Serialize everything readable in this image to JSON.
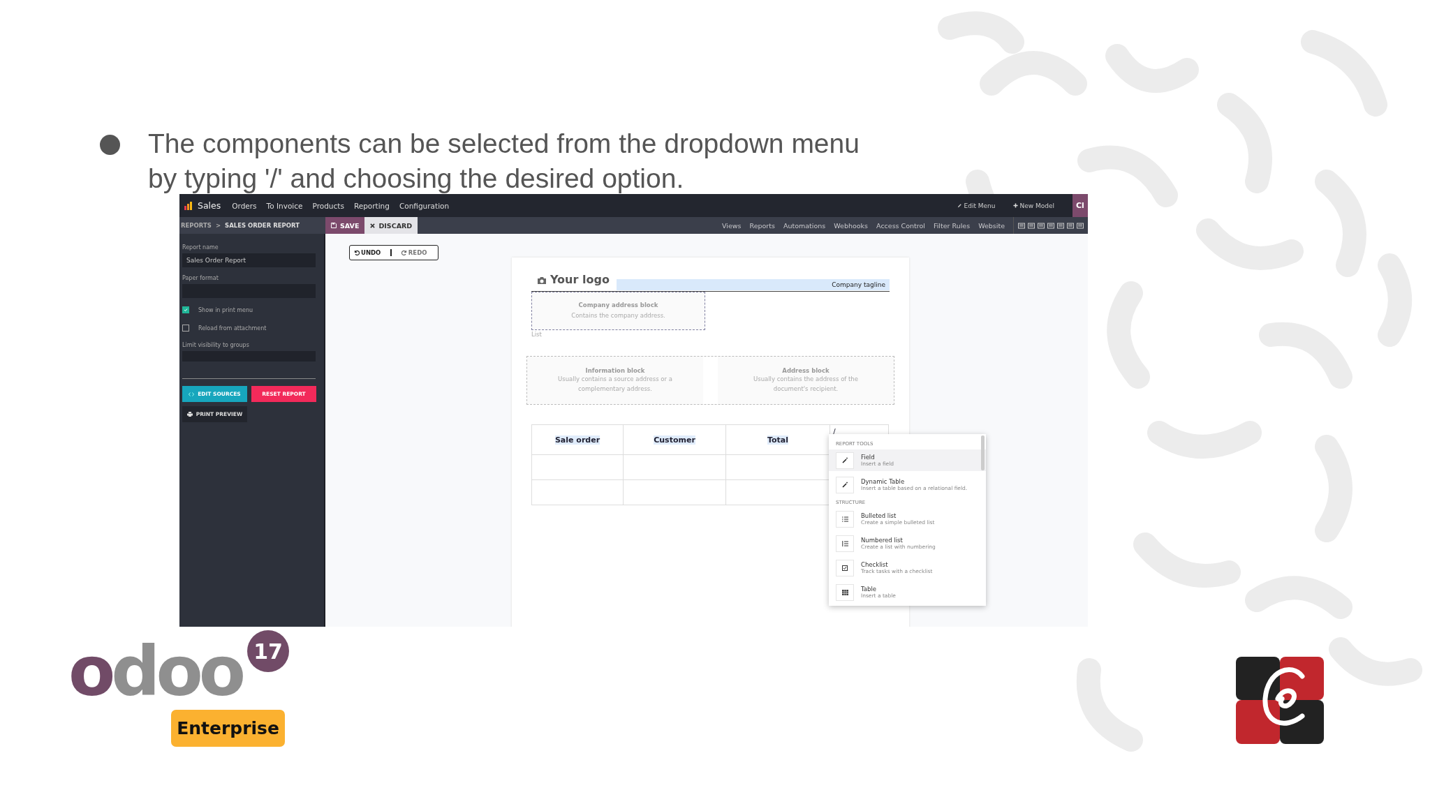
{
  "slide": {
    "bullet_text": "The components can be selected from the dropdown menu by typing '/' and choosing the desired option."
  },
  "app": {
    "app_name": "Sales",
    "menu": [
      "Orders",
      "To Invoice",
      "Products",
      "Reporting",
      "Configuration"
    ],
    "topbar_right": [
      {
        "kind": "edit",
        "label": "Edit Menu"
      },
      {
        "kind": "new",
        "label": "New Model"
      }
    ],
    "close_button": "Cl",
    "breadcrumbs": [
      "REPORTS",
      "SALES ORDER REPORT"
    ],
    "breadcrumb_separator": ">",
    "save": "SAVE",
    "discard": "DISCARD",
    "studio_tabs": [
      "Views",
      "Reports",
      "Automations",
      "Webhooks",
      "Access Control",
      "Filter Rules",
      "Website"
    ]
  },
  "sidebar": {
    "fields": [
      {
        "label": "Report name",
        "value": "Sales Order Report"
      },
      {
        "label": "Paper format"
      }
    ],
    "checkboxes": [
      {
        "label": "Show in print menu",
        "checked": true
      },
      {
        "label": "Reload from attachment",
        "checked": false
      }
    ],
    "groups_label": "Limit visibility to groups",
    "buttons": [
      {
        "kind": "edit",
        "label": "EDIT SOURCES"
      },
      {
        "kind": "reset",
        "label": "RESET REPORT"
      },
      {
        "kind": "print",
        "label": "PRINT PREVIEW"
      }
    ]
  },
  "toolbar": {
    "undo": "UNDO",
    "redo": "REDO"
  },
  "document": {
    "logo": "Your logo",
    "tagline": "Company tagline",
    "company_block": {
      "title": "Company address block",
      "text": "Contains the company address."
    },
    "list_label": "List",
    "info_block": {
      "title": "Information block",
      "text": "Usually contains a source address or a complementary address."
    },
    "address_block": {
      "title": "Address block",
      "text": "Usually contains the address of the document's recipient."
    },
    "table": {
      "columns": [
        "Sale order",
        "Customer",
        "Total"
      ],
      "typed": "/"
    }
  },
  "command_menu": {
    "sections": [
      {
        "title": "REPORT TOOLS",
        "items": [
          {
            "kind": "field",
            "title": "Field",
            "description": "Insert a field",
            "selected": true
          },
          {
            "kind": "field",
            "title": "Dynamic Table",
            "description": "Insert a table based on a relational field.",
            "selected": false
          }
        ]
      },
      {
        "title": "STRUCTURE",
        "items": [
          {
            "kind": "bullets",
            "title": "Bulleted list",
            "description": "Create a simple bulleted list",
            "selected": false
          },
          {
            "kind": "numbers",
            "title": "Numbered list",
            "description": "Create a list with numbering",
            "selected": false
          },
          {
            "kind": "checklist",
            "title": "Checklist",
            "description": "Track tasks with a checklist",
            "selected": false
          },
          {
            "kind": "table",
            "title": "Table",
            "description": "Insert a table",
            "selected": false
          }
        ]
      }
    ]
  },
  "logo": {
    "name": "odoo",
    "version": "17",
    "edition": "Enterprise"
  }
}
